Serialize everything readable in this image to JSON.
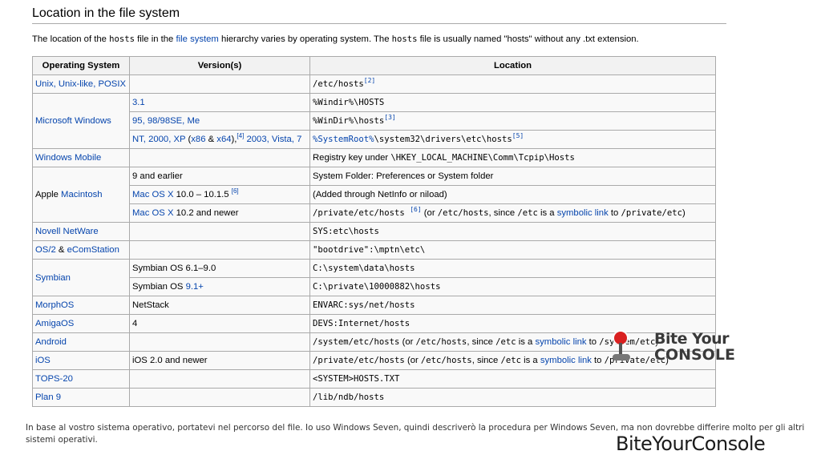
{
  "heading": "Location in the file system",
  "intro": {
    "p1": "The location of the ",
    "code1": "hosts",
    "p2": " file in the ",
    "link": "file system",
    "p3": " hierarchy varies by operating system. The ",
    "code2": "hosts",
    "p4": " file is usually named \"hosts\" without any .txt extension."
  },
  "table": {
    "headers": [
      "Operating System",
      "Version(s)",
      "Location"
    ],
    "rows": {
      "unix": {
        "os": "Unix, Unix-like, POSIX",
        "loc": "/etc/hosts",
        "ref": "[2]"
      },
      "ms1": {
        "os": "Microsoft Windows",
        "ver": "3.1",
        "loc": "%Windir%\\HOSTS"
      },
      "ms2": {
        "ver": "95, 98/98SE, Me",
        "loc": "%WinDir%\\hosts",
        "ref": "[3]"
      },
      "ms3": {
        "ver_nt": "NT, 2000, XP",
        "ver_paren_open": " (",
        "ver_x86": "x86",
        "ver_amp": " & ",
        "ver_x64": "x64",
        "ver_paren_close": "),",
        "ver_ref": "[4]",
        "ver_2003": " 2003, Vista, 7",
        "loc_link": "%SystemRoot%",
        "loc_rest": "\\system32\\drivers\\etc\\hosts",
        "ref": "[5]"
      },
      "wm": {
        "os": "Windows Mobile",
        "loc_text": "Registry key under ",
        "loc_code": "\\HKEY_LOCAL_MACHINE\\Comm\\Tcpip\\Hosts"
      },
      "mac1": {
        "os_plain": "Apple ",
        "os_link": "Macintosh",
        "ver": "9 and earlier",
        "loc": "System Folder: Preferences or System folder"
      },
      "mac2": {
        "ver_link": "Mac OS X",
        "ver_rest": " 10.0 – 10.1.5 ",
        "ver_ref": "[6]",
        "loc": "(Added through NetInfo or niload)"
      },
      "mac3": {
        "ver_link": "Mac OS X",
        "ver_rest": " 10.2 and newer",
        "loc_code": "/private/etc/hosts",
        "ref": "[6]",
        "t1": " (or ",
        "c2": "/etc/hosts",
        "t2": ", since ",
        "c3": "/etc",
        "t3": " is a ",
        "link": "symbolic link",
        "t4": " to ",
        "c4": "/private/etc",
        "t5": ")"
      },
      "novell": {
        "os": "Novell NetWare",
        "loc": "SYS:etc\\hosts"
      },
      "os2": {
        "os_link1": "OS/2",
        "os_amp": " & ",
        "os_link2": "eComStation",
        "loc": "\"bootdrive\":\\mptn\\etc\\"
      },
      "sym1": {
        "os": "Symbian",
        "ver": "Symbian OS 6.1–9.0",
        "loc": "C:\\system\\data\\hosts"
      },
      "sym2": {
        "ver_plain": "Symbian OS ",
        "ver_link": "9.1+",
        "loc": "C:\\private\\10000882\\hosts"
      },
      "morph": {
        "os": "MorphOS",
        "ver": "NetStack",
        "loc": "ENVARC:sys/net/hosts"
      },
      "amiga": {
        "os": "AmigaOS",
        "ver": "4",
        "loc": "DEVS:Internet/hosts"
      },
      "android": {
        "os": "Android",
        "loc_code": "/system/etc/hosts",
        "t1": " (or ",
        "c2": "/etc/hosts",
        "t2": ", since ",
        "c3": "/etc",
        "t3": " is a ",
        "link": "symbolic link",
        "t4": " to ",
        "c4": "/system/etc",
        "t5": ")"
      },
      "ios": {
        "os": "iOS",
        "ver": "iOS 2.0 and newer",
        "loc_code": "/private/etc/hosts",
        "t1": " (or ",
        "c2": "/etc/hosts",
        "t2": ", since ",
        "c3": "/etc",
        "t3": " is a ",
        "link": "symbolic link",
        "t4": " to ",
        "c4": "/private/etc",
        "t5": ")"
      },
      "tops": {
        "os": "TOPS-20",
        "loc": "<SYSTEM>HOSTS.TXT"
      },
      "plan9": {
        "os": "Plan 9",
        "loc": "/lib/ndb/hosts"
      }
    }
  },
  "footer": "In base al vostro sistema operativo, portatevi nel percorso del file. Io uso Windows Seven, quindi descriverò la procedura per Windows Seven, ma non dovrebbe differire molto per gli altri sistemi operativi.",
  "watermark": {
    "line1": "Bite Your",
    "line2": "CONSOLE",
    "brand": "BiteYourConsole"
  },
  "colors": {
    "link": "#0645ad",
    "border": "#aaaaaa",
    "header_bg": "#f2f2f2",
    "table_bg": "#f9f9f9",
    "joystick_ball": "#d92020"
  }
}
